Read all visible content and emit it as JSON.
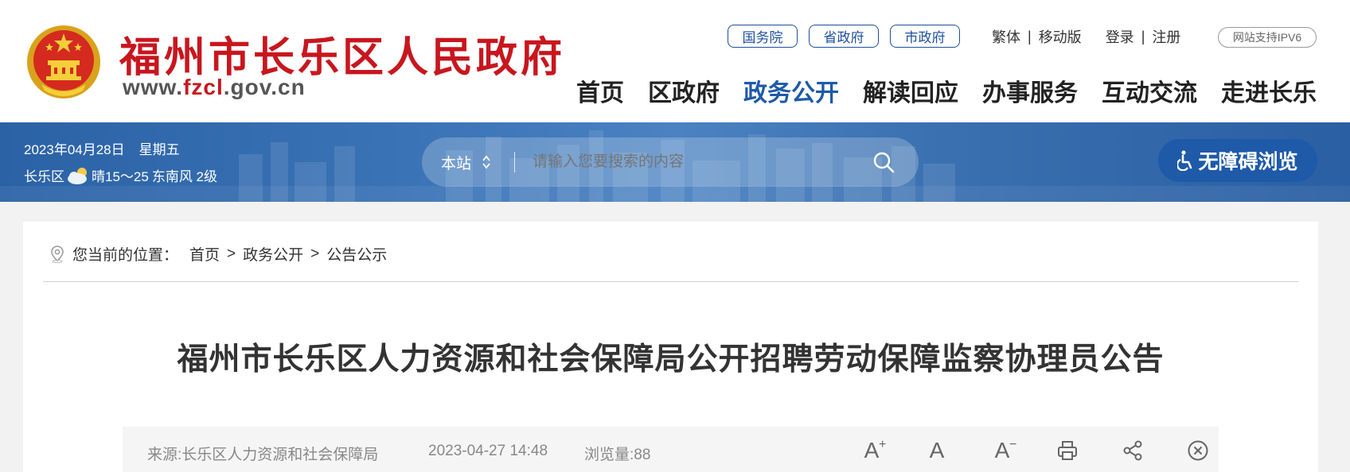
{
  "header": {
    "site_title": "福州市长乐区人民政府",
    "site_url_prefix": "www.",
    "site_url_highlight": "fzcl",
    "site_url_suffix": ".gov.cn",
    "gov_links": [
      "国务院",
      "省政府",
      "市政府"
    ],
    "top_links": {
      "traditional": "繁体",
      "mobile": "移动版",
      "login": "登录",
      "register": "注册",
      "separator": "|"
    },
    "ipv6_badge": "网站支持IPV6",
    "nav": [
      {
        "label": "首页",
        "active": false
      },
      {
        "label": "区政府",
        "active": false
      },
      {
        "label": "政务公开",
        "active": true
      },
      {
        "label": "解读回应",
        "active": false
      },
      {
        "label": "办事服务",
        "active": false
      },
      {
        "label": "互动交流",
        "active": false
      },
      {
        "label": "走进长乐",
        "active": false
      }
    ],
    "colors": {
      "brand_red": "#c8161e",
      "brand_blue": "#1e5aa8"
    }
  },
  "banner": {
    "date": "2023年04月28日",
    "weekday": "星期五",
    "district": "长乐区",
    "weather_icon": "partly-cloudy-icon",
    "weather_text": "晴",
    "temperature": "15～25",
    "wind": "东南风 2级",
    "search": {
      "scope": "本站",
      "placeholder": "请输入您要搜索的内容"
    },
    "accessibility_label": "无障碍浏览"
  },
  "breadcrumb": {
    "label": "您当前的位置：",
    "items": [
      "首页",
      "政务公开",
      "公告公示"
    ],
    "separator": ">"
  },
  "article": {
    "title": "福州市长乐区人力资源和社会保障局公开招聘劳动保障监察协理员公告",
    "source": "来源:长乐区人力资源和社会保障局",
    "datetime": "2023-04-27 14:48",
    "views": "浏览量:88",
    "tools": {
      "increase_font": "A",
      "normal_font": "A",
      "decrease_font": "A",
      "plus": "+",
      "minus": "−"
    }
  }
}
